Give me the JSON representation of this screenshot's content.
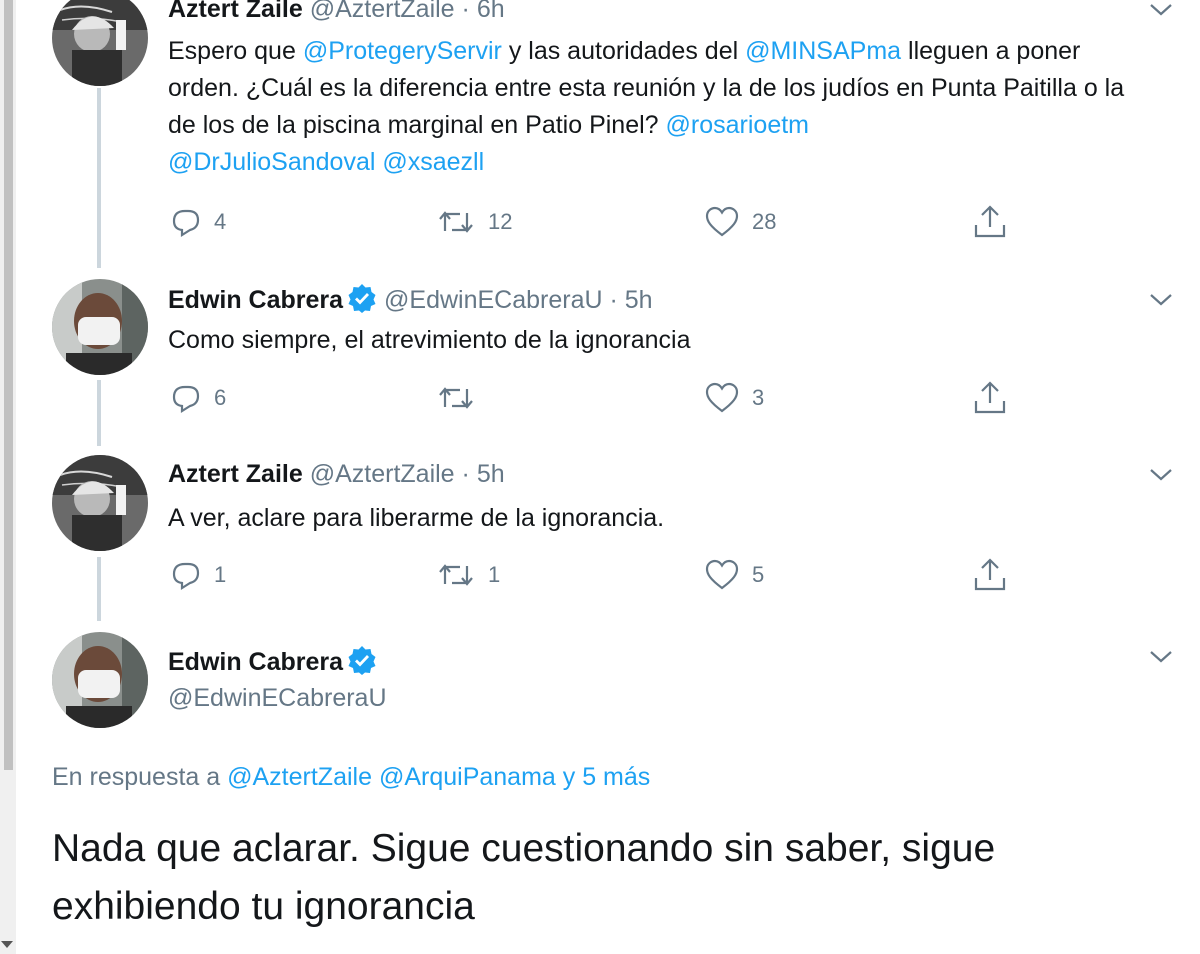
{
  "colors": {
    "link": "#1da1f2",
    "muted": "#657786",
    "text": "#14171a",
    "verified": "#1da1f2",
    "thread_line": "#ccd6dd"
  },
  "tweets": [
    {
      "name": "Aztert Zaile",
      "handle": "@AztertZaile",
      "sep": "·",
      "time": "6h",
      "text_parts": [
        "Espero que ",
        "@ProtegeryServir",
        " y las autoridades del ",
        "@MINSAPma",
        " lleguen a poner orden. ¿Cuál es la diferencia entre esta reunión y la de los judíos en Punta Paitilla o la de los de la piscina marginal en Patio Pinel? ",
        "@rosarioetm",
        " ",
        "@DrJulioSandoval",
        " ",
        "@xsaezll"
      ],
      "replies": "4",
      "retweets": "12",
      "likes": "28"
    },
    {
      "name": "Edwin Cabrera",
      "handle": "@EdwinECabreraU",
      "sep": "·",
      "time": "5h",
      "text": "Como siempre, el atrevimiento de la ignorancia",
      "replies": "6",
      "retweets": "",
      "likes": "3"
    },
    {
      "name": "Aztert Zaile",
      "handle": "@AztertZaile",
      "sep": "·",
      "time": "5h",
      "text": "A ver, aclare para liberarme de la ignorancia.",
      "replies": "1",
      "retweets": "1",
      "likes": "5"
    }
  ],
  "main_tweet": {
    "name": "Edwin Cabrera",
    "handle": "@EdwinECabreraU",
    "reply_prefix": "En respuesta a ",
    "reply_to_1": "@AztertZaile",
    "reply_to_2": "@ArquiPanama",
    "reply_more": "y 5 más",
    "text": "Nada que aclarar. Sigue cuestionando sin saber, sigue exhibiendo tu ignorancia"
  },
  "icons": [
    "reply-icon",
    "retweet-icon",
    "like-icon",
    "share-icon",
    "chevron-down-icon",
    "verified-badge-icon"
  ]
}
